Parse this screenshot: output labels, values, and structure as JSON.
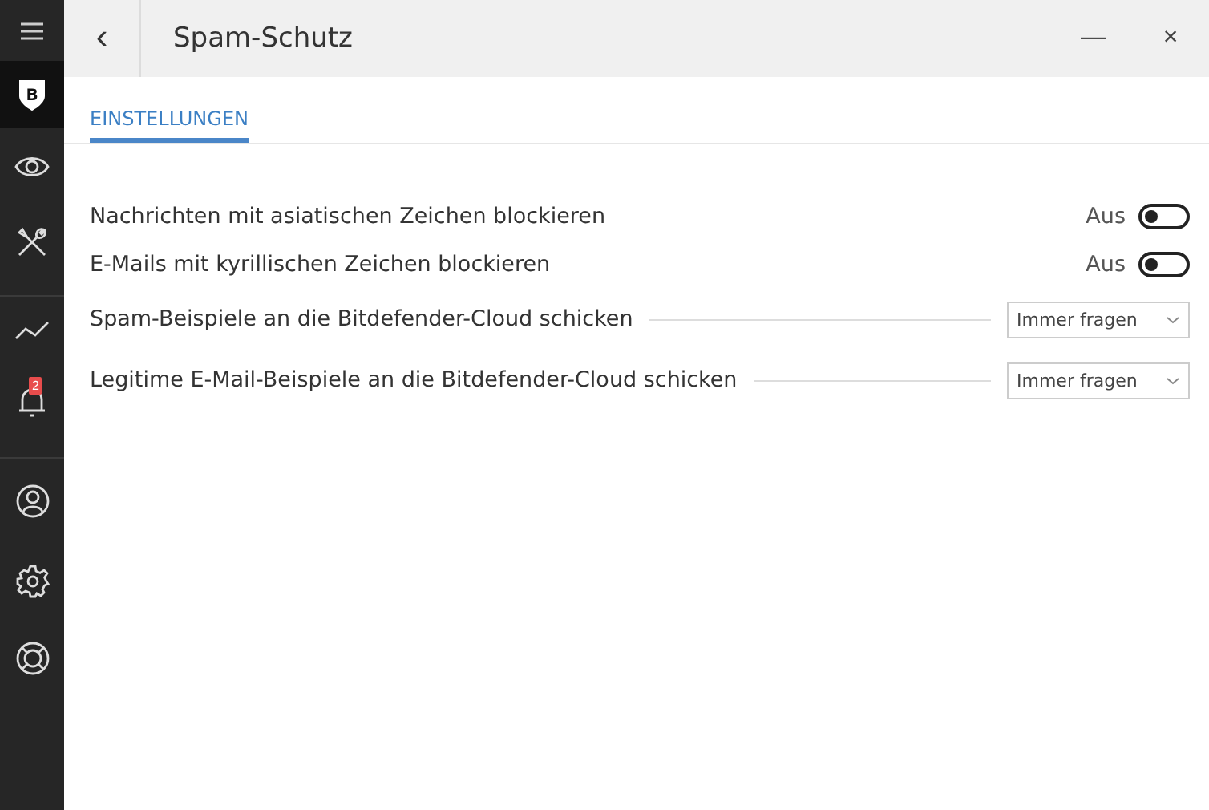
{
  "sidebar": {
    "items": [
      {
        "kind": "menu",
        "selected": false
      },
      {
        "kind": "shield",
        "label": "B",
        "selected": true
      },
      {
        "kind": "eye",
        "selected": false
      },
      {
        "kind": "tools",
        "selected": false
      },
      {
        "kind": "divider"
      },
      {
        "kind": "chart",
        "selected": false
      },
      {
        "kind": "bell",
        "badge": "2",
        "selected": false
      },
      {
        "kind": "divider"
      },
      {
        "kind": "user",
        "selected": false
      },
      {
        "kind": "gear",
        "selected": false
      },
      {
        "kind": "lifebuoy",
        "selected": false
      }
    ]
  },
  "window": {
    "back": "‹",
    "title": "Spam-Schutz",
    "minimize": "—",
    "close": "×"
  },
  "tabs": [
    {
      "label": "EINSTELLUNGEN",
      "selected": true
    }
  ],
  "settings": [
    {
      "kind": "toggle",
      "label": "Nachrichten mit asiatischen Zeichen blockieren",
      "state": "Aus",
      "on": false
    },
    {
      "kind": "toggle",
      "label": "E-Mails mit kyrillischen Zeichen blockieren",
      "state": "Aus",
      "on": false
    },
    {
      "kind": "select",
      "label": "Spam-Beispiele an die Bitdefender-Cloud schicken",
      "value": "Immer fragen"
    },
    {
      "kind": "select",
      "label": "Legitime E-Mail-Beispiele an die Bitdefender-Cloud schicken",
      "value": "Immer fragen"
    }
  ]
}
